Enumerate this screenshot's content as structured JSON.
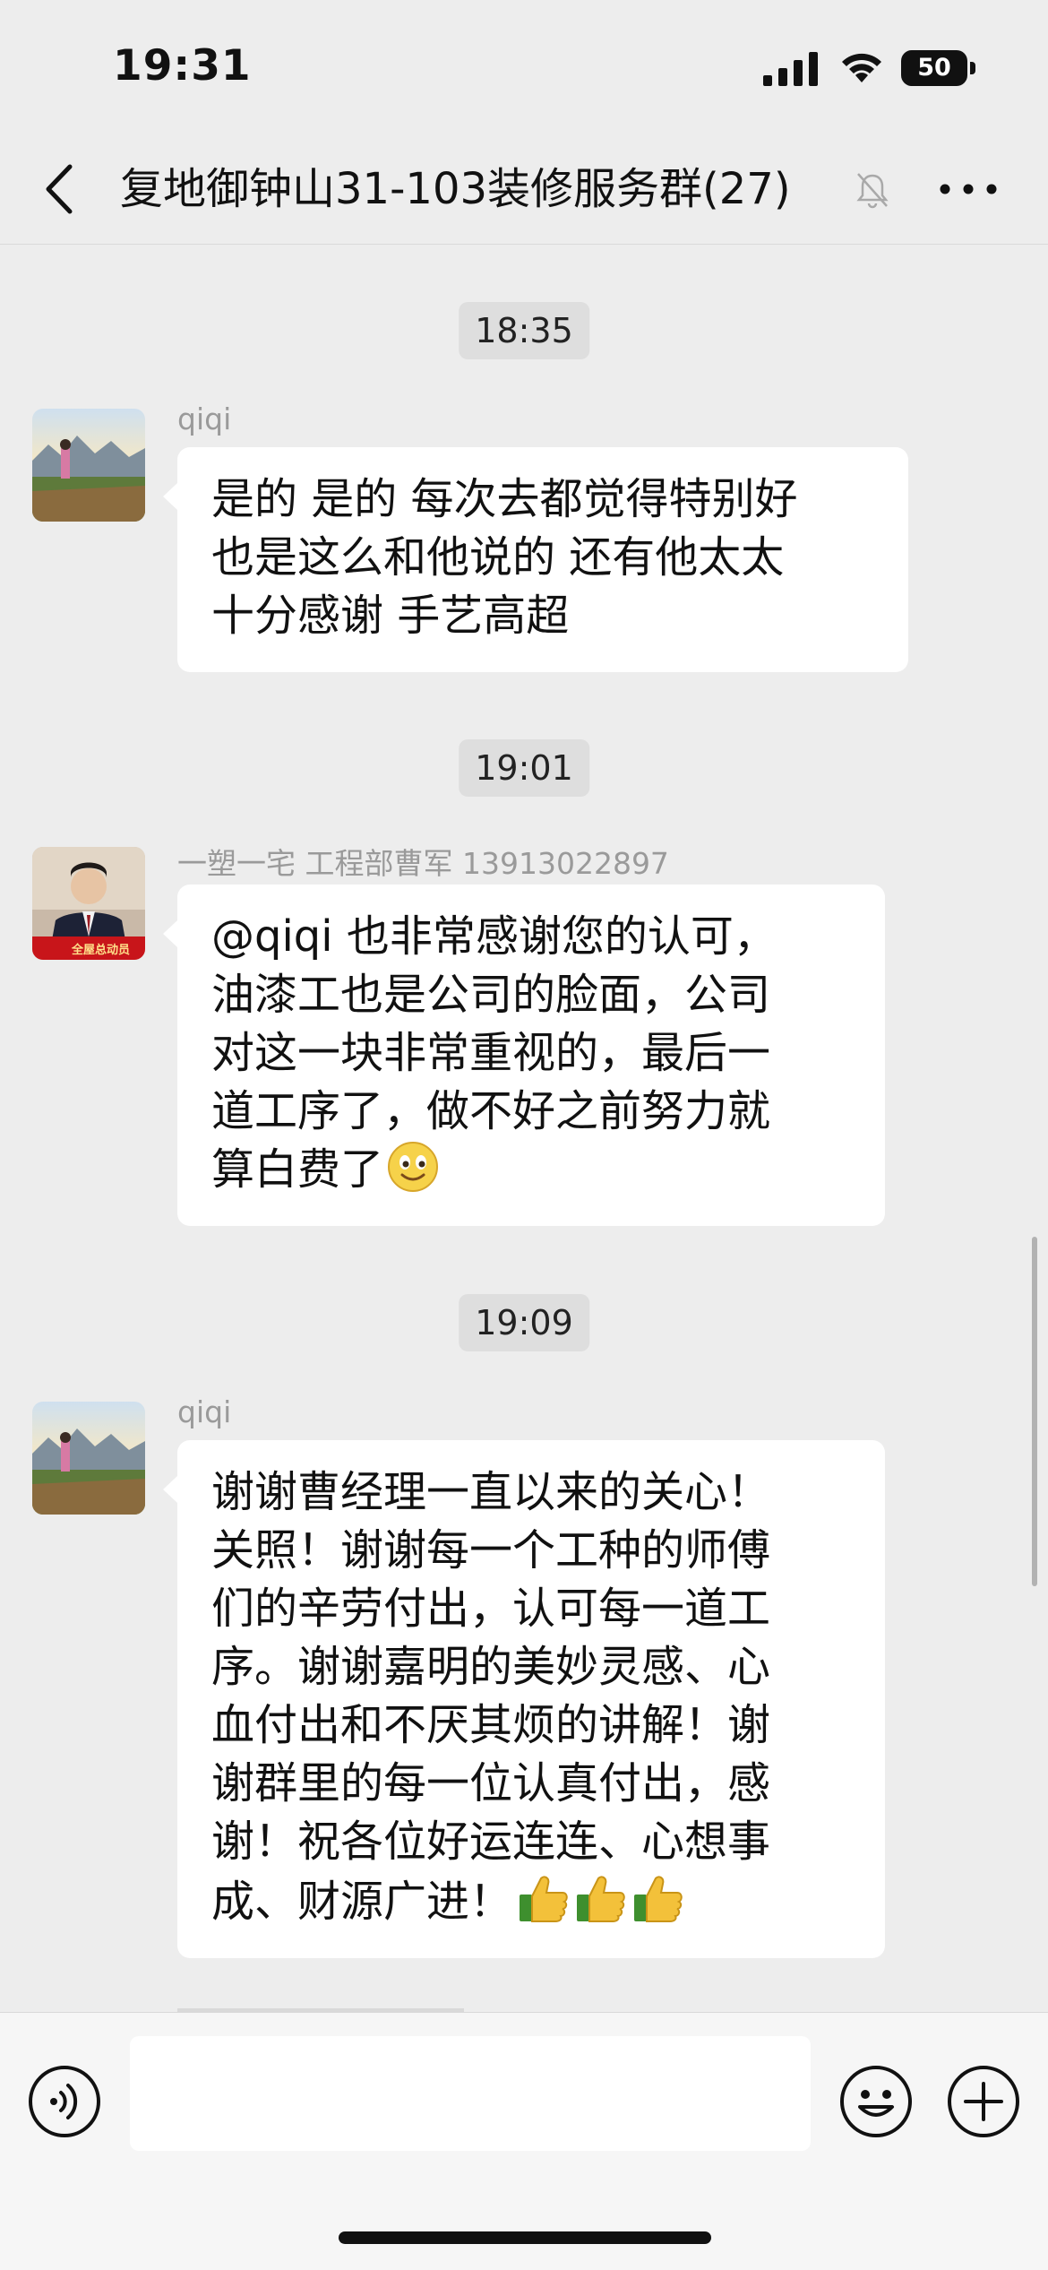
{
  "status_bar": {
    "time": "19:31",
    "battery": "50"
  },
  "nav": {
    "title": "复地御钟山31-103装修服务群",
    "member_count": "(27)",
    "icons": {
      "back": "chevron-left-icon",
      "mute": "bell-slash-icon",
      "more": "ellipsis-icon"
    }
  },
  "messages": [
    {
      "type": "time",
      "text": "18:35"
    },
    {
      "type": "message",
      "sender": "qiqi",
      "avatar": "landscape-photo",
      "lines": [
        "是的 是的 每次去都觉得特别好",
        " 也是这么和他说的 还有他太太",
        " 十分感谢 手艺高超"
      ]
    },
    {
      "type": "time",
      "text": "19:01"
    },
    {
      "type": "message",
      "sender": "一塑一宅 工程部曹军 13913022897",
      "avatar": "man-in-suit-photo",
      "avatar_badge": "全屋总动员",
      "lines": [
        "@qiqi 也非常感谢您的认可，",
        "油漆工也是公司的脸面，公司",
        "对这一块非常重视的，最后一",
        "道工序了，做不好之前努力就",
        "算白费了"
      ],
      "trailing_emoji": "smile-emoji"
    },
    {
      "type": "time",
      "text": "19:09"
    },
    {
      "type": "message",
      "sender": "qiqi",
      "avatar": "landscape-photo",
      "lines": [
        "谢谢曹经理一直以来的关心！",
        "关照！谢谢每一个工种的师傅",
        "们的辛劳付出，认可每一道工",
        "序。谢谢嘉明的美妙灵感、心",
        "血付出和不厌其烦的讲解！谢",
        "谢群里的每一位认真付出，感",
        "谢！祝各位好运连连、心想事",
        "成、财源广进！"
      ],
      "trailing_emoji": "thumbs-up-emoji",
      "trailing_emoji_count": 3
    }
  ],
  "input": {
    "value": "",
    "placeholder": "",
    "icons": {
      "voice": "voice-icon",
      "emoji": "emoji-icon",
      "more": "plus-icon"
    }
  },
  "colors": {
    "background": "#ededed",
    "bubble": "#ffffff",
    "time_chip": "#dedede",
    "sender_name": "#9a9a9a"
  }
}
